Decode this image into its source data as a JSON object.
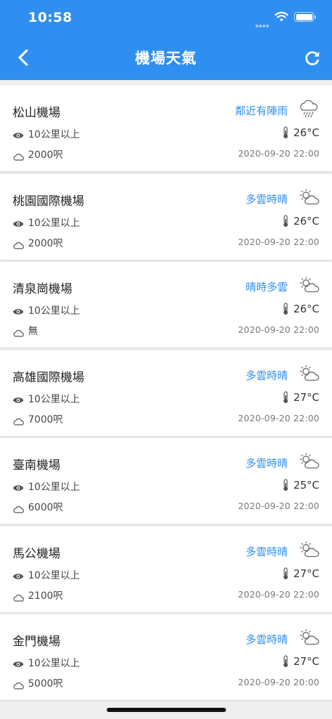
{
  "status_bar": {
    "time": "10:58"
  },
  "header": {
    "title": "機場天氣"
  },
  "colors": {
    "accent": "#2f8ff0",
    "background": "#efefef"
  },
  "airports": [
    {
      "name": "松山機場",
      "condition": "鄰近有陣雨",
      "icon": "rain-cloud-icon",
      "visibility": "10公里以上",
      "temperature": "26°C",
      "ceiling": "2000呎",
      "time": "2020-09-20 22:00"
    },
    {
      "name": "桃園國際機場",
      "condition": "多雲時晴",
      "icon": "partly-cloudy-icon",
      "visibility": "10公里以上",
      "temperature": "26°C",
      "ceiling": "2000呎",
      "time": "2020-09-20 22:00"
    },
    {
      "name": "清泉崗機場",
      "condition": "晴時多雲",
      "icon": "partly-cloudy-icon",
      "visibility": "10公里以上",
      "temperature": "26°C",
      "ceiling": "無",
      "time": "2020-09-20 22:00"
    },
    {
      "name": "高雄國際機場",
      "condition": "多雲時晴",
      "icon": "partly-cloudy-icon",
      "visibility": "10公里以上",
      "temperature": "27°C",
      "ceiling": "7000呎",
      "time": "2020-09-20 22:00"
    },
    {
      "name": "臺南機場",
      "condition": "多雲時晴",
      "icon": "partly-cloudy-icon",
      "visibility": "10公里以上",
      "temperature": "25°C",
      "ceiling": "6000呎",
      "time": "2020-09-20 22:00"
    },
    {
      "name": "馬公機場",
      "condition": "多雲時晴",
      "icon": "partly-cloudy-icon",
      "visibility": "10公里以上",
      "temperature": "27°C",
      "ceiling": "2100呎",
      "time": "2020-09-20 22:00"
    },
    {
      "name": "金門機場",
      "condition": "多雲時晴",
      "icon": "partly-cloudy-icon",
      "visibility": "10公里以上",
      "temperature": "27°C",
      "ceiling": "5000呎",
      "time": "2020-09-20 20:00"
    }
  ]
}
